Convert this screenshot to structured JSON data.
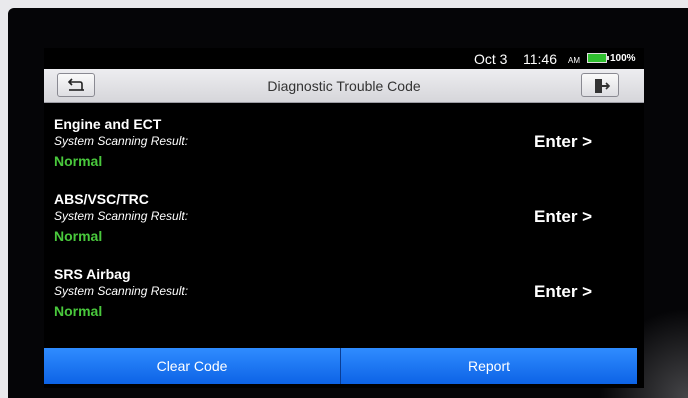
{
  "status_bar": {
    "date": "Oct 3",
    "time": "11:46",
    "ampm": "AM",
    "battery": "100%",
    "battery_color": "#2fbf2f"
  },
  "title_bar": {
    "title": "Diagnostic Trouble Code",
    "back_icon": "back-arrow-icon",
    "exit_icon": "exit-door-icon"
  },
  "systems": [
    {
      "name": "Engine and ECT",
      "label": "System Scanning Result:",
      "status": "Normal",
      "enter": "Enter >"
    },
    {
      "name": "ABS/VSC/TRC",
      "label": "System Scanning Result:",
      "status": "Normal",
      "enter": "Enter >"
    },
    {
      "name": "SRS Airbag",
      "label": "System Scanning Result:",
      "status": "Normal",
      "enter": "Enter >"
    }
  ],
  "actions": {
    "clear_code": "Clear Code",
    "report": "Report"
  },
  "colors": {
    "status_ok": "#49c83c",
    "button_blue": "#1a73f0"
  }
}
